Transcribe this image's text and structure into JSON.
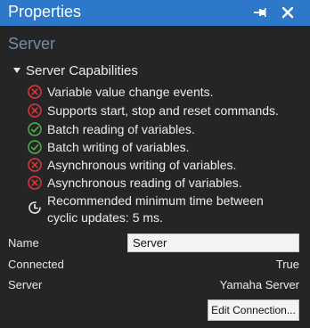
{
  "panel": {
    "title": "Properties",
    "pin_icon": "pin-icon",
    "close_icon": "close-icon"
  },
  "object": {
    "name": "Server"
  },
  "capabilities": {
    "header": "Server Capabilities",
    "items": [
      {
        "text": "Variable value change events.",
        "status": "unsupported",
        "icon": "error-circle-icon"
      },
      {
        "text": "Supports start, stop and reset commands.",
        "status": "unsupported",
        "icon": "error-circle-icon"
      },
      {
        "text": "Batch reading of variables.",
        "status": "supported",
        "icon": "check-circle-icon"
      },
      {
        "text": "Batch writing of variables.",
        "status": "supported",
        "icon": "check-circle-icon"
      },
      {
        "text": "Asynchronous writing of variables.",
        "status": "unsupported",
        "icon": "error-circle-icon"
      },
      {
        "text": "Asynchronous reading of variables.",
        "status": "unsupported",
        "icon": "error-circle-icon"
      },
      {
        "text": "Recommended minimum time between cyclic updates: 5 ms.",
        "status": "info",
        "icon": "clock-icon"
      }
    ]
  },
  "properties": {
    "name_label": "Name",
    "name_value": "Server",
    "connected_label": "Connected",
    "connected_value": "True",
    "server_label": "Server",
    "server_value": "Yamaha Server"
  },
  "actions": {
    "edit_connection_label": "Edit Connection..."
  },
  "colors": {
    "title_bar": "#2d78c8",
    "background": "#252526",
    "error": "#e0353b",
    "success": "#4fb24a",
    "object_name": "#6f8fab"
  }
}
